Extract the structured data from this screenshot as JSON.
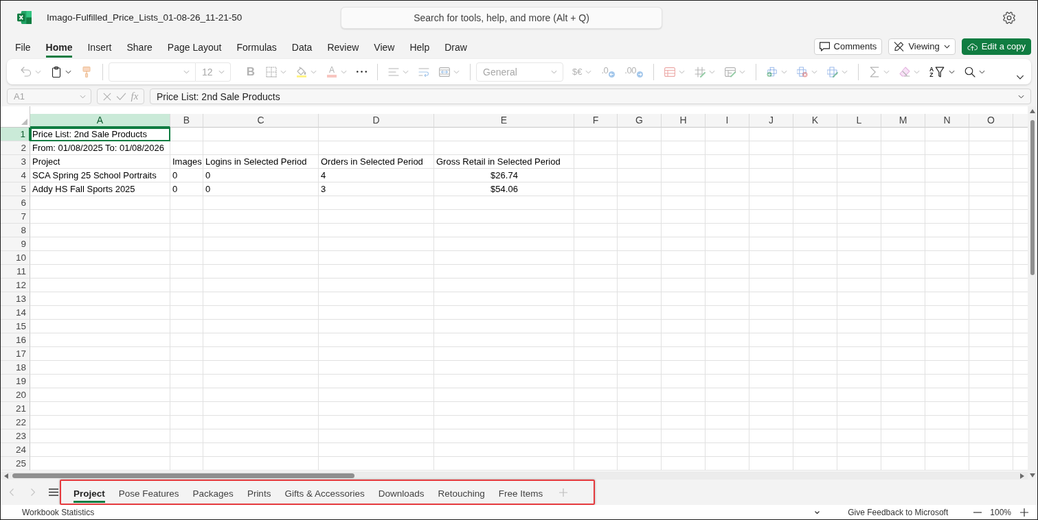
{
  "title_bar": {
    "title": "Imago-Fulfilled_Price_Lists_01-08-26_11-21-50",
    "search_placeholder": "Search for tools, help, and more (Alt + Q)"
  },
  "ribbon_tabs": [
    {
      "label": "File",
      "selected": false
    },
    {
      "label": "Home",
      "selected": true
    },
    {
      "label": "Insert",
      "selected": false
    },
    {
      "label": "Share",
      "selected": false
    },
    {
      "label": "Page Layout",
      "selected": false
    },
    {
      "label": "Formulas",
      "selected": false
    },
    {
      "label": "Data",
      "selected": false
    },
    {
      "label": "Review",
      "selected": false
    },
    {
      "label": "View",
      "selected": false
    },
    {
      "label": "Help",
      "selected": false
    },
    {
      "label": "Draw",
      "selected": false
    }
  ],
  "ribbon_actions": [
    {
      "kind": "comments",
      "label": "Comments"
    },
    {
      "kind": "mode",
      "label": "Viewing"
    },
    {
      "kind": "edit",
      "label": "Edit a copy"
    }
  ],
  "toolbar": [
    [
      {
        "kind": "undo",
        "caret": true,
        "disabled": true
      },
      {
        "kind": "paste",
        "caret": true,
        "disabled": false
      },
      {
        "kind": "format-painter",
        "caret": false,
        "disabled": true
      }
    ],
    [
      {
        "kind": "font-name",
        "disabled": true
      },
      {
        "kind": "font-size",
        "value": "12",
        "disabled": true
      },
      {
        "kind": "bold",
        "text": "B",
        "caret": false,
        "disabled": true
      },
      {
        "kind": "borders",
        "caret": true,
        "disabled": true
      },
      {
        "kind": "fill",
        "caret": true,
        "disabled": true
      },
      {
        "kind": "font-color",
        "text": "A",
        "caret": true,
        "disabled": true
      },
      {
        "kind": "more",
        "caret": false,
        "disabled": false
      }
    ],
    [
      {
        "kind": "align",
        "caret": true,
        "disabled": true
      },
      {
        "kind": "wrap",
        "caret": false,
        "disabled": true
      },
      {
        "kind": "merge",
        "caret": true,
        "disabled": true
      }
    ],
    [
      {
        "kind": "number-format",
        "value": "General",
        "disabled": true
      },
      {
        "kind": "currency",
        "text": "$€",
        "caret": true,
        "disabled": true
      },
      {
        "kind": "increase-decimal",
        "text": ".0",
        "caret": false,
        "disabled": true
      },
      {
        "kind": "decrease-decimal",
        "text": ".00",
        "caret": false,
        "disabled": true
      }
    ],
    [
      {
        "kind": "conditional",
        "caret": true,
        "disabled": true
      },
      {
        "kind": "table",
        "caret": true,
        "disabled": true
      },
      {
        "kind": "styles",
        "caret": true,
        "disabled": true
      }
    ],
    [
      {
        "kind": "insert",
        "caret": true,
        "disabled": true
      },
      {
        "kind": "delete",
        "caret": true,
        "disabled": true
      },
      {
        "kind": "format",
        "caret": true,
        "disabled": true
      }
    ],
    [
      {
        "kind": "sum",
        "caret": true,
        "disabled": true
      },
      {
        "kind": "clear",
        "caret": true,
        "disabled": true
      },
      {
        "kind": "sort",
        "letters": [
          "A",
          "Z"
        ],
        "caret": true,
        "disabled": false
      },
      {
        "kind": "find",
        "caret": true,
        "disabled": false
      }
    ]
  ],
  "formula_bar": {
    "name_box": {
      "value": "A1",
      "disabled": true
    },
    "function_label": "fx",
    "formula": "Price List: 2nd Sale Products"
  },
  "sheet": {
    "columns": [
      {
        "label": "A",
        "selected": true
      },
      {
        "label": "B",
        "selected": false
      },
      {
        "label": "C",
        "selected": false
      },
      {
        "label": "D",
        "selected": false
      },
      {
        "label": "E",
        "selected": false
      },
      {
        "label": "F",
        "selected": false
      },
      {
        "label": "G",
        "selected": false
      },
      {
        "label": "H",
        "selected": false
      },
      {
        "label": "I",
        "selected": false
      },
      {
        "label": "J",
        "selected": false
      },
      {
        "label": "K",
        "selected": false
      },
      {
        "label": "L",
        "selected": false
      },
      {
        "label": "M",
        "selected": false
      },
      {
        "label": "N",
        "selected": false
      },
      {
        "label": "O",
        "selected": false
      }
    ],
    "rows": [
      {
        "label": "1",
        "selected": true,
        "cells": [
          {
            "text": "Price List: 2nd Sale Products",
            "centered": false
          }
        ]
      },
      {
        "label": "2",
        "selected": false,
        "cells": [
          {
            "text": "From: 01/08/2025 To: 01/08/2026",
            "centered": false
          }
        ]
      },
      {
        "label": "3",
        "selected": false,
        "cells": [
          {
            "text": "Project",
            "centered": false
          },
          {
            "text": "Images",
            "centered": false
          },
          {
            "text": "Logins in Selected Period",
            "centered": false
          },
          {
            "text": "Orders in Selected Period",
            "centered": false
          },
          {
            "text": "Gross Retail in Selected Period",
            "centered": false
          }
        ]
      },
      {
        "label": "4",
        "selected": false,
        "cells": [
          {
            "text": "SCA Spring 25 School Portraits",
            "centered": false
          },
          {
            "text": "0",
            "centered": false
          },
          {
            "text": "0",
            "centered": false
          },
          {
            "text": "4",
            "centered": false
          },
          {
            "text": "$26.74",
            "centered": true
          }
        ]
      },
      {
        "label": "5",
        "selected": false,
        "cells": [
          {
            "text": "Addy HS Fall Sports 2025",
            "centered": false
          },
          {
            "text": "0",
            "centered": false
          },
          {
            "text": "0",
            "centered": false
          },
          {
            "text": "3",
            "centered": false
          },
          {
            "text": "$54.06",
            "centered": true
          }
        ]
      },
      {
        "label": "6",
        "selected": false
      },
      {
        "label": "7",
        "selected": false
      },
      {
        "label": "8",
        "selected": false
      },
      {
        "label": "9",
        "selected": false
      },
      {
        "label": "10",
        "selected": false
      },
      {
        "label": "11",
        "selected": false
      },
      {
        "label": "12",
        "selected": false
      },
      {
        "label": "13",
        "selected": false
      },
      {
        "label": "14",
        "selected": false
      },
      {
        "label": "15",
        "selected": false
      },
      {
        "label": "16",
        "selected": false
      },
      {
        "label": "17",
        "selected": false
      },
      {
        "label": "18",
        "selected": false
      },
      {
        "label": "19",
        "selected": false
      },
      {
        "label": "20",
        "selected": false
      },
      {
        "label": "21",
        "selected": false
      },
      {
        "label": "22",
        "selected": false
      },
      {
        "label": "23",
        "selected": false
      },
      {
        "label": "24",
        "selected": false
      },
      {
        "label": "25",
        "selected": false
      }
    ]
  },
  "sheet_tabs": [
    {
      "label": "Project",
      "selected": true
    },
    {
      "label": "Pose Features",
      "selected": false
    },
    {
      "label": "Packages",
      "selected": false
    },
    {
      "label": "Prints",
      "selected": false
    },
    {
      "label": "Gifts & Accessories",
      "selected": false
    },
    {
      "label": "Downloads",
      "selected": false
    },
    {
      "label": "Retouching",
      "selected": false
    },
    {
      "label": "Free Items",
      "selected": false
    }
  ],
  "status_bar": {
    "label": "Workbook Statistics",
    "feedback": "Give Feedback to Microsoft",
    "zoom": "100%"
  }
}
